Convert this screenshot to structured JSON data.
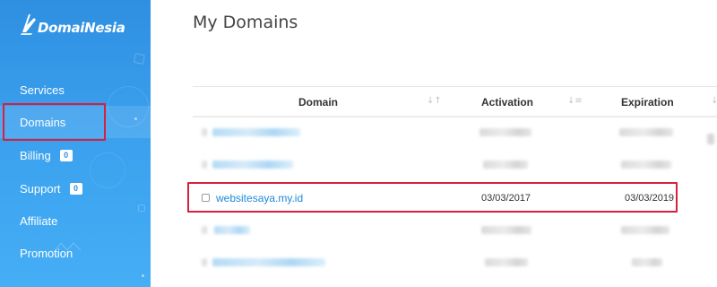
{
  "brand": {
    "logo_text": "DomaiNesia"
  },
  "sidebar": {
    "items": [
      {
        "label": "Services"
      },
      {
        "label": "Domains",
        "active": true
      },
      {
        "label": "Billing",
        "badge": "0"
      },
      {
        "label": "Support",
        "badge": "0"
      },
      {
        "label": "Affiliate"
      },
      {
        "label": "Promotion"
      }
    ]
  },
  "main": {
    "title": "My Domains",
    "table": {
      "columns": [
        "Domain",
        "Activation",
        "Expiration"
      ],
      "highlighted_row": {
        "domain": "websitesaya.my.id",
        "activation": "03/03/2017",
        "expiration": "03/03/2019"
      }
    }
  },
  "colors": {
    "sidebar_blue": "#2f8fe0",
    "link_blue": "#1e8ad9",
    "highlight_red": "#d5213f"
  },
  "icons": [
    "domainesia-logo-icon",
    "sort-icon",
    "checkbox-icon"
  ]
}
